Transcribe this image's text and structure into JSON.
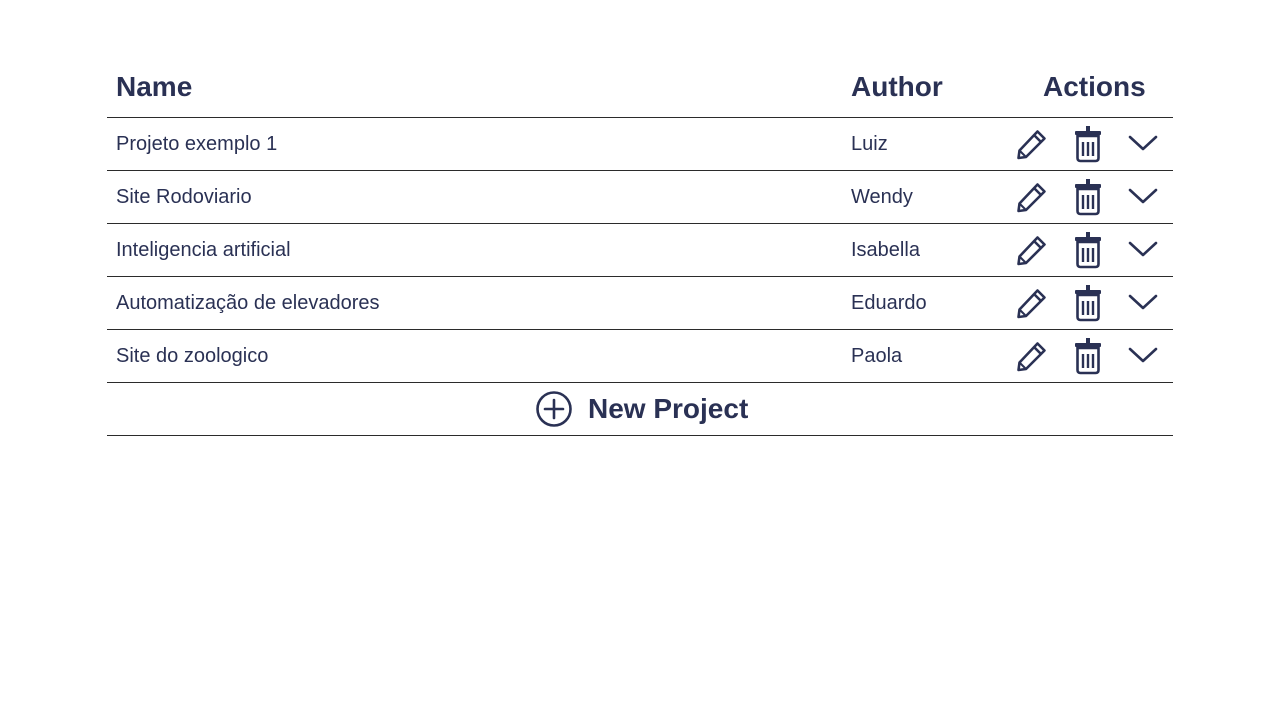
{
  "table": {
    "headers": {
      "name": "Name",
      "author": "Author",
      "actions": "Actions"
    },
    "rows": [
      {
        "name": "Projeto exemplo 1",
        "author": "Luiz"
      },
      {
        "name": "Site Rodoviario",
        "author": "Wendy"
      },
      {
        "name": "Inteligencia artificial",
        "author": "Isabella"
      },
      {
        "name": "Automatização de elevadores",
        "author": "Eduardo"
      },
      {
        "name": "Site do zoologico",
        "author": "Paola"
      }
    ],
    "row_actions": [
      "pencil-icon",
      "trash-icon",
      "chevron-down-icon"
    ],
    "new_project": {
      "label": "New Project",
      "icon": "plus-circle-icon"
    }
  },
  "colors": {
    "text": "#2a3154",
    "divider": "#2b2b2b",
    "background": "#ffffff"
  }
}
